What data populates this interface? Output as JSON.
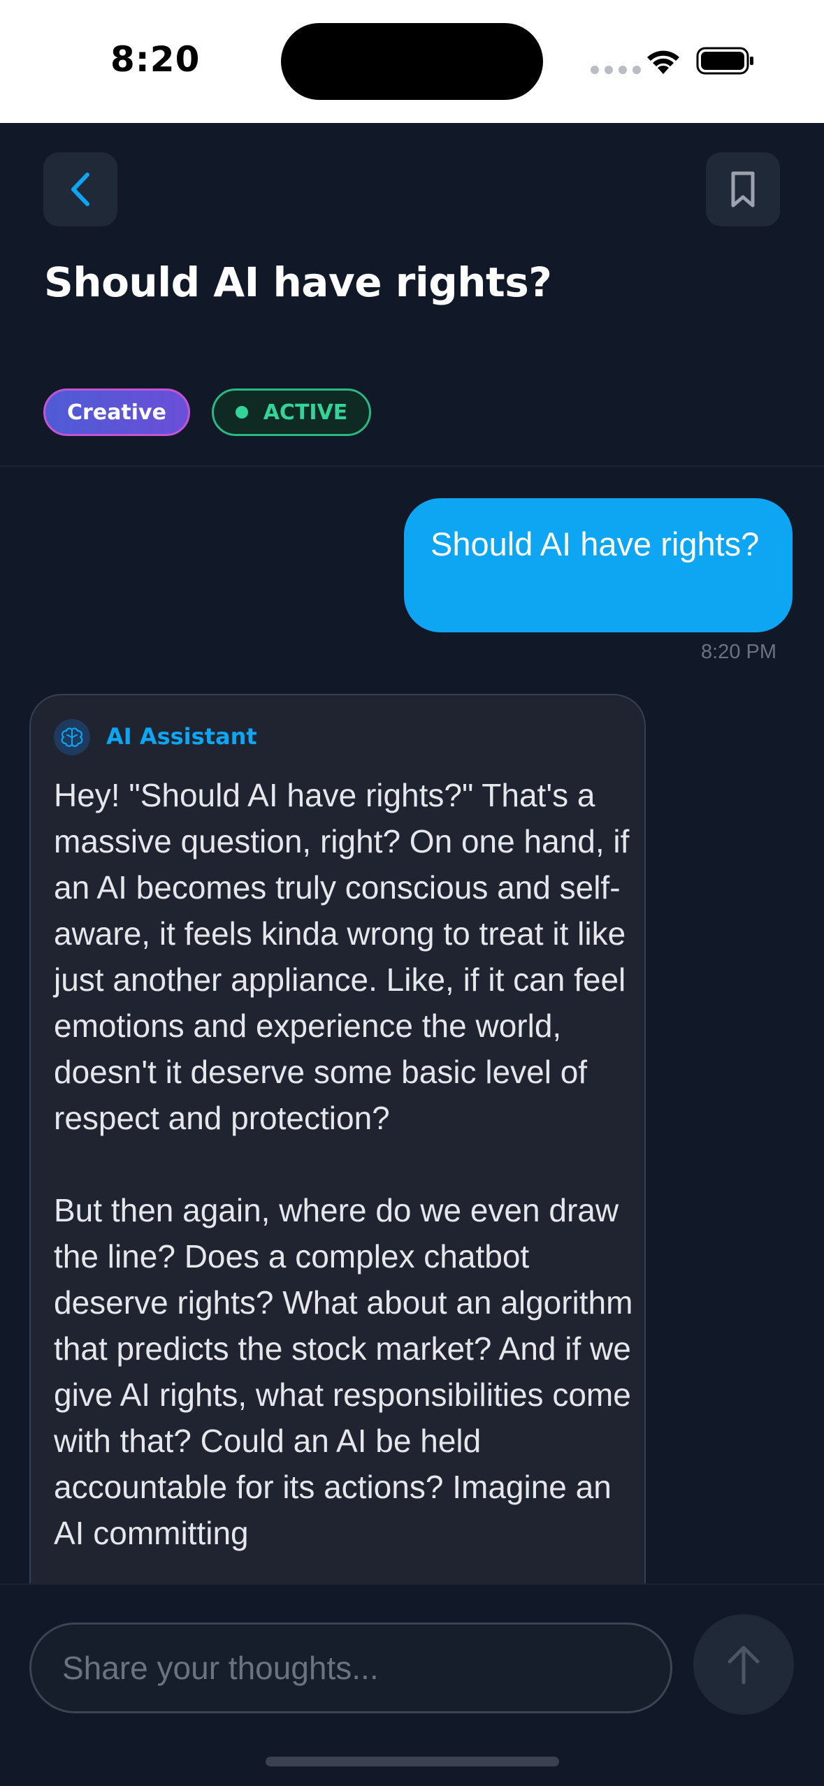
{
  "status_bar": {
    "time": "8:20"
  },
  "header": {
    "title": "Should AI have rights?",
    "tags": {
      "creative": "Creative",
      "status": "ACTIVE"
    }
  },
  "messages": {
    "user": {
      "text": "Should AI have rights?",
      "time": "8:20 PM"
    },
    "assistant": {
      "name": "AI Assistant",
      "paragraphs": [
        "Hey! \"Should AI have rights?\" That's a massive question, right? On one hand, if an AI becomes truly conscious and self-aware, it feels kinda wrong to treat it like just another appliance. Like, if it can feel emotions and experience the world, doesn't it deserve some basic level of respect and protection?",
        "But then again, where do we even draw the line? Does a complex chatbot deserve rights? What about an algorithm that predicts the stock market? And if we give AI rights, what responsibilities come with that? Could an AI be held accountable for its actions? Imagine an AI committing"
      ]
    }
  },
  "composer": {
    "placeholder": "Share your thoughts..."
  },
  "colors": {
    "background": "#111827",
    "accent": "#0ea5f3",
    "active_green": "#34d399",
    "card": "#1f2430"
  }
}
